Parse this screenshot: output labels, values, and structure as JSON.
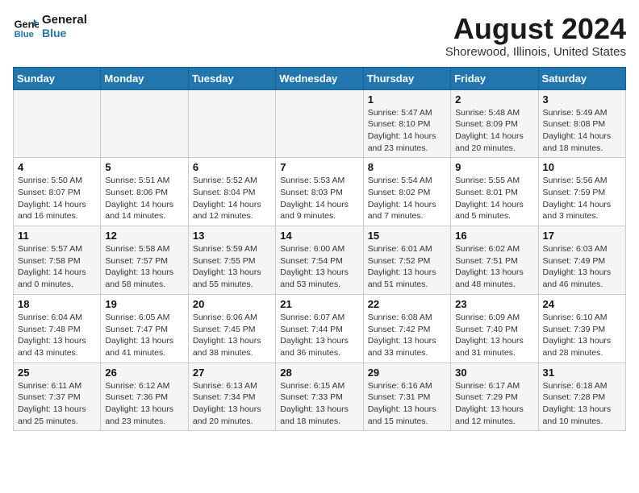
{
  "logo": {
    "line1": "General",
    "line2": "Blue"
  },
  "title": "August 2024",
  "subtitle": "Shorewood, Illinois, United States",
  "days_of_week": [
    "Sunday",
    "Monday",
    "Tuesday",
    "Wednesday",
    "Thursday",
    "Friday",
    "Saturday"
  ],
  "weeks": [
    [
      {
        "day": "",
        "info": ""
      },
      {
        "day": "",
        "info": ""
      },
      {
        "day": "",
        "info": ""
      },
      {
        "day": "",
        "info": ""
      },
      {
        "day": "1",
        "info": "Sunrise: 5:47 AM\nSunset: 8:10 PM\nDaylight: 14 hours\nand 23 minutes."
      },
      {
        "day": "2",
        "info": "Sunrise: 5:48 AM\nSunset: 8:09 PM\nDaylight: 14 hours\nand 20 minutes."
      },
      {
        "day": "3",
        "info": "Sunrise: 5:49 AM\nSunset: 8:08 PM\nDaylight: 14 hours\nand 18 minutes."
      }
    ],
    [
      {
        "day": "4",
        "info": "Sunrise: 5:50 AM\nSunset: 8:07 PM\nDaylight: 14 hours\nand 16 minutes."
      },
      {
        "day": "5",
        "info": "Sunrise: 5:51 AM\nSunset: 8:06 PM\nDaylight: 14 hours\nand 14 minutes."
      },
      {
        "day": "6",
        "info": "Sunrise: 5:52 AM\nSunset: 8:04 PM\nDaylight: 14 hours\nand 12 minutes."
      },
      {
        "day": "7",
        "info": "Sunrise: 5:53 AM\nSunset: 8:03 PM\nDaylight: 14 hours\nand 9 minutes."
      },
      {
        "day": "8",
        "info": "Sunrise: 5:54 AM\nSunset: 8:02 PM\nDaylight: 14 hours\nand 7 minutes."
      },
      {
        "day": "9",
        "info": "Sunrise: 5:55 AM\nSunset: 8:01 PM\nDaylight: 14 hours\nand 5 minutes."
      },
      {
        "day": "10",
        "info": "Sunrise: 5:56 AM\nSunset: 7:59 PM\nDaylight: 14 hours\nand 3 minutes."
      }
    ],
    [
      {
        "day": "11",
        "info": "Sunrise: 5:57 AM\nSunset: 7:58 PM\nDaylight: 14 hours\nand 0 minutes."
      },
      {
        "day": "12",
        "info": "Sunrise: 5:58 AM\nSunset: 7:57 PM\nDaylight: 13 hours\nand 58 minutes."
      },
      {
        "day": "13",
        "info": "Sunrise: 5:59 AM\nSunset: 7:55 PM\nDaylight: 13 hours\nand 55 minutes."
      },
      {
        "day": "14",
        "info": "Sunrise: 6:00 AM\nSunset: 7:54 PM\nDaylight: 13 hours\nand 53 minutes."
      },
      {
        "day": "15",
        "info": "Sunrise: 6:01 AM\nSunset: 7:52 PM\nDaylight: 13 hours\nand 51 minutes."
      },
      {
        "day": "16",
        "info": "Sunrise: 6:02 AM\nSunset: 7:51 PM\nDaylight: 13 hours\nand 48 minutes."
      },
      {
        "day": "17",
        "info": "Sunrise: 6:03 AM\nSunset: 7:49 PM\nDaylight: 13 hours\nand 46 minutes."
      }
    ],
    [
      {
        "day": "18",
        "info": "Sunrise: 6:04 AM\nSunset: 7:48 PM\nDaylight: 13 hours\nand 43 minutes."
      },
      {
        "day": "19",
        "info": "Sunrise: 6:05 AM\nSunset: 7:47 PM\nDaylight: 13 hours\nand 41 minutes."
      },
      {
        "day": "20",
        "info": "Sunrise: 6:06 AM\nSunset: 7:45 PM\nDaylight: 13 hours\nand 38 minutes."
      },
      {
        "day": "21",
        "info": "Sunrise: 6:07 AM\nSunset: 7:44 PM\nDaylight: 13 hours\nand 36 minutes."
      },
      {
        "day": "22",
        "info": "Sunrise: 6:08 AM\nSunset: 7:42 PM\nDaylight: 13 hours\nand 33 minutes."
      },
      {
        "day": "23",
        "info": "Sunrise: 6:09 AM\nSunset: 7:40 PM\nDaylight: 13 hours\nand 31 minutes."
      },
      {
        "day": "24",
        "info": "Sunrise: 6:10 AM\nSunset: 7:39 PM\nDaylight: 13 hours\nand 28 minutes."
      }
    ],
    [
      {
        "day": "25",
        "info": "Sunrise: 6:11 AM\nSunset: 7:37 PM\nDaylight: 13 hours\nand 25 minutes."
      },
      {
        "day": "26",
        "info": "Sunrise: 6:12 AM\nSunset: 7:36 PM\nDaylight: 13 hours\nand 23 minutes."
      },
      {
        "day": "27",
        "info": "Sunrise: 6:13 AM\nSunset: 7:34 PM\nDaylight: 13 hours\nand 20 minutes."
      },
      {
        "day": "28",
        "info": "Sunrise: 6:15 AM\nSunset: 7:33 PM\nDaylight: 13 hours\nand 18 minutes."
      },
      {
        "day": "29",
        "info": "Sunrise: 6:16 AM\nSunset: 7:31 PM\nDaylight: 13 hours\nand 15 minutes."
      },
      {
        "day": "30",
        "info": "Sunrise: 6:17 AM\nSunset: 7:29 PM\nDaylight: 13 hours\nand 12 minutes."
      },
      {
        "day": "31",
        "info": "Sunrise: 6:18 AM\nSunset: 7:28 PM\nDaylight: 13 hours\nand 10 minutes."
      }
    ]
  ]
}
